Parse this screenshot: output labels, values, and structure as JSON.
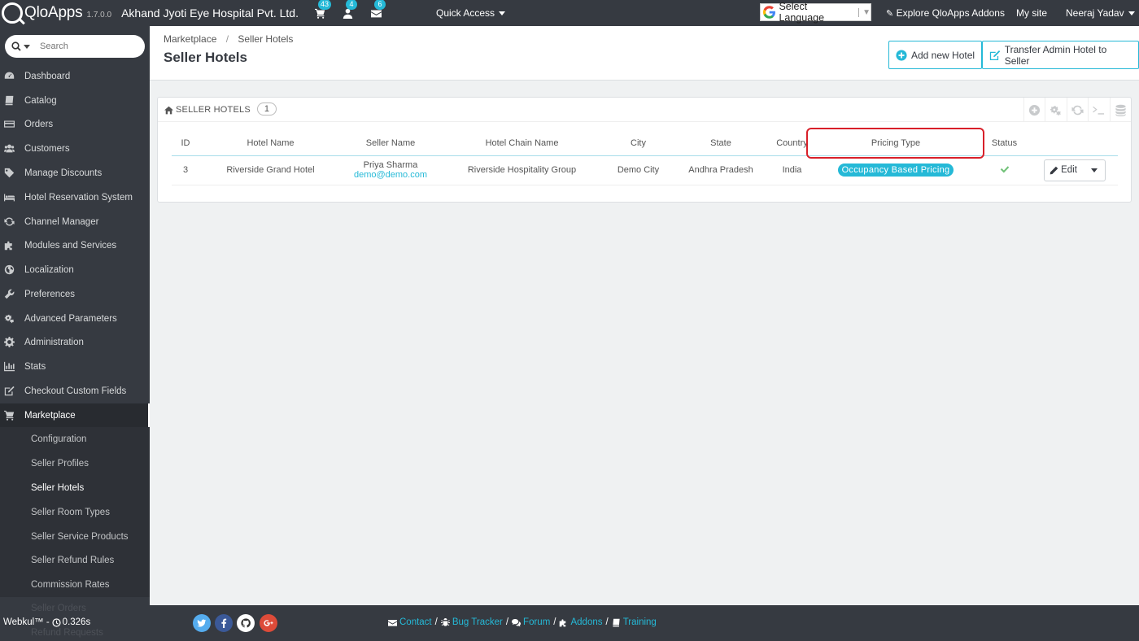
{
  "header": {
    "logo_text": "QloApps",
    "version": "1.7.0.0",
    "shop_name": "Akhand Jyoti Eye Hospital Pvt. Ltd.",
    "notifications": {
      "orders": "43",
      "customers": "4",
      "messages": "6"
    },
    "quick_access": "Quick Access",
    "language": "Select Language",
    "addons_link": "Explore QloApps Addons",
    "my_site": "My site",
    "user": "Neeraj Yadav"
  },
  "sidebar": {
    "search_placeholder": "Search",
    "items": [
      {
        "label": "Dashboard",
        "icon": "dashboard-icon"
      },
      {
        "label": "Catalog",
        "icon": "book-icon"
      },
      {
        "label": "Orders",
        "icon": "credit-card-icon"
      },
      {
        "label": "Customers",
        "icon": "users-icon"
      },
      {
        "label": "Manage Discounts",
        "icon": "tag-icon"
      },
      {
        "label": "Hotel Reservation System",
        "icon": "bed-icon"
      },
      {
        "label": "Channel Manager",
        "icon": "refresh-icon"
      },
      {
        "label": "Modules and Services",
        "icon": "puzzle-icon"
      },
      {
        "label": "Localization",
        "icon": "globe-icon"
      },
      {
        "label": "Preferences",
        "icon": "wrench-icon"
      },
      {
        "label": "Advanced Parameters",
        "icon": "cogs-icon"
      },
      {
        "label": "Administration",
        "icon": "gear-icon"
      },
      {
        "label": "Stats",
        "icon": "bar-chart-icon"
      },
      {
        "label": "Checkout Custom Fields",
        "icon": "edit-icon"
      },
      {
        "label": "Marketplace",
        "icon": "cart-icon"
      }
    ],
    "sub_items": [
      "Configuration",
      "Seller Profiles",
      "Seller Hotels",
      "Seller Room Types",
      "Seller Service Products",
      "Seller Refund Rules",
      "Commission Rates",
      "Seller Orders",
      "Refund Requests"
    ]
  },
  "page": {
    "breadcrumb": [
      "Marketplace",
      "Seller Hotels"
    ],
    "title": "Seller Hotels",
    "add_button": "Add new Hotel",
    "transfer_button": "Transfer Admin Hotel to Seller"
  },
  "panel": {
    "title": "Seller Hotels",
    "count": "1",
    "columns": [
      "ID",
      "Hotel Name",
      "Seller Name",
      "Hotel Chain Name",
      "City",
      "State",
      "Country",
      "Pricing Type",
      "Status"
    ],
    "rows": [
      {
        "id": "3",
        "hotel_name": "Riverside Grand Hotel",
        "seller_name": "Priya Sharma",
        "seller_email": "demo@demo.com",
        "chain": "Riverside Hospitality Group",
        "city": "Demo City",
        "state": "Andhra Pradesh",
        "country": "India",
        "pricing_type": "Occupancy Based Pricing",
        "status": "enabled",
        "edit_label": "Edit"
      }
    ]
  },
  "footer": {
    "brand": "Webkul™ -",
    "load_time": "0.326s",
    "links": [
      "Contact",
      "Bug Tracker",
      "Forum",
      "Addons",
      "Training"
    ]
  },
  "colors": {
    "accent": "#25b9d7",
    "sidebar_bg": "#363a41",
    "highlight": "#d8202a",
    "success": "#72c279"
  }
}
